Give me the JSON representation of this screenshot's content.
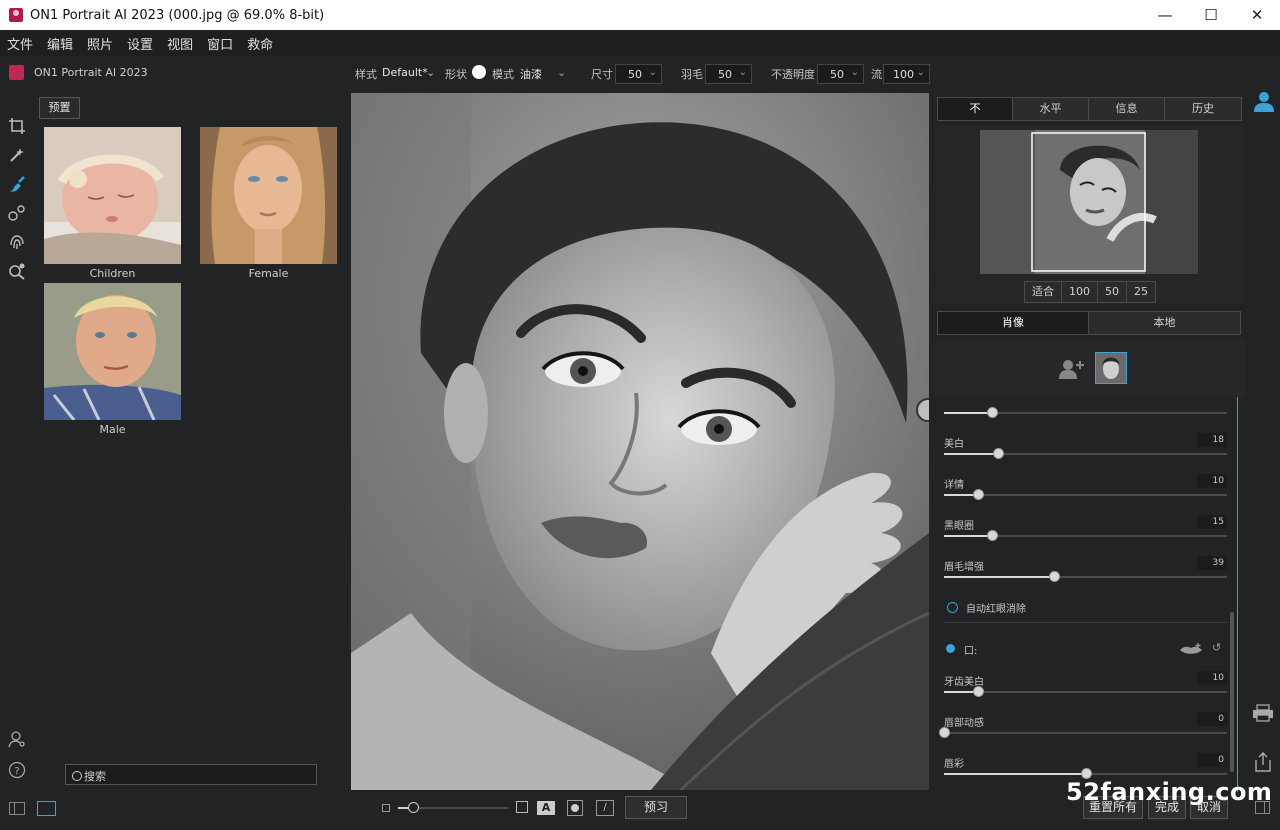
{
  "window": {
    "title": "ON1 Portrait AI 2023 (000.jpg @ 69.0% 8-bit)",
    "minimize": "—",
    "maximize": "☐",
    "close": "✕"
  },
  "menu": [
    "文件",
    "编辑",
    "照片",
    "设置",
    "视图",
    "窗口",
    "救命"
  ],
  "app_name": "ON1 Portrait AI 2023",
  "brush_toolbar": {
    "style_label": "样式",
    "style_value": "Default*",
    "shape_label": "形状",
    "mode_label": "模式",
    "mode_value": "油漆",
    "size_label": "尺寸",
    "size_value": "50",
    "feather_label": "羽毛",
    "feather_value": "50",
    "opacity_label": "不透明度",
    "opacity_value": "50",
    "flow_label": "流",
    "flow_value": "100"
  },
  "presets": {
    "button": "预置",
    "items": [
      {
        "label": "Children"
      },
      {
        "label": "Female"
      },
      {
        "label": "Male"
      }
    ],
    "search_placeholder": "搜索"
  },
  "right_panel": {
    "top_tabs": [
      "不",
      "水平",
      "信息",
      "历史"
    ],
    "zoom_options": [
      "适合",
      "100",
      "50",
      "25"
    ],
    "mode_tabs": [
      "肖像",
      "本地"
    ],
    "sliders": [
      {
        "label": "",
        "value": "",
        "level": 0.17
      },
      {
        "label": "美白",
        "value": "18",
        "level": 0.19
      },
      {
        "label": "详情",
        "value": "10",
        "level": 0.12
      },
      {
        "label": "黑眼圈",
        "value": "15",
        "level": 0.17
      },
      {
        "label": "眉毛增强",
        "value": "39",
        "level": 0.39
      }
    ],
    "redeye_label": "自动红眼消除",
    "mouth_section": "口:",
    "mouth_sliders": [
      {
        "label": "牙齿美白",
        "value": "10",
        "level": 0.12
      },
      {
        "label": "唇部动感",
        "value": "0",
        "level": 0.0
      },
      {
        "label": "唇彩",
        "value": "0",
        "level": 0.5
      }
    ]
  },
  "bottom": {
    "preview_button": "预习",
    "reset_all": "重置所有",
    "done": "完成",
    "cancel": "取消",
    "watermark": "52fanxing.com"
  },
  "colors": {
    "accent": "#3aa3d8",
    "brand": "#c22656"
  }
}
